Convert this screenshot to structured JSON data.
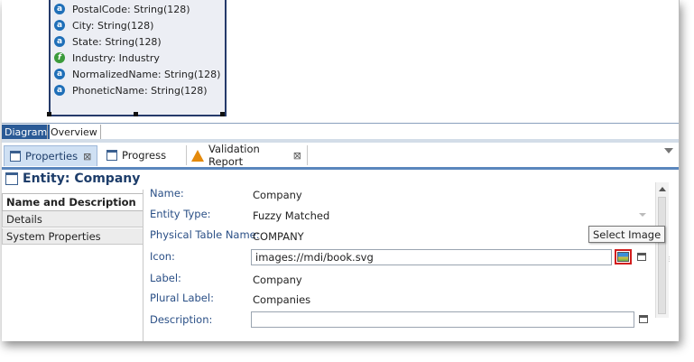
{
  "diagram": {
    "attributes": [
      {
        "type": "a",
        "text": "PostalCode: String(128)"
      },
      {
        "type": "a",
        "text": "City: String(128)"
      },
      {
        "type": "a",
        "text": "State: String(128)"
      },
      {
        "type": "f",
        "text": "Industry: Industry"
      },
      {
        "type": "a",
        "text": "NormalizedName: String(128)"
      },
      {
        "type": "a",
        "text": "PhoneticName: String(128)"
      }
    ],
    "tabs": {
      "diagram": "Diagram",
      "overview": "Overview"
    }
  },
  "view_tabs": {
    "properties": "Properties",
    "progress": "Progress",
    "validation": "Validation Report",
    "close_glyph": "⊠"
  },
  "entity_title": "Entity: Company",
  "sidebar": {
    "items": [
      "Name and Description",
      "Details",
      "System Properties"
    ]
  },
  "properties": {
    "name_label": "Name:",
    "name_value": "Company",
    "type_label": "Entity Type:",
    "type_value": "Fuzzy Matched",
    "table_label": "Physical Table Name:",
    "table_value": "COMPANY",
    "icon_label": "Icon:",
    "icon_value": "images://mdi/book.svg",
    "label_label": "Label:",
    "label_value": "Company",
    "plural_label": "Plural Label:",
    "plural_value": "Companies",
    "desc_label": "Description:",
    "desc_value": ""
  },
  "tooltip": "Select Image",
  "icons": {
    "attribute": "attribute-icon",
    "lookup": "lookup-attribute-icon",
    "warning": "warning-icon",
    "image": "select-image-icon",
    "window": "window-icon"
  },
  "colors": {
    "accent": "#2a5a96",
    "label": "#2a4f86",
    "highlight": "#d21d1d",
    "warning": "#e48a0c"
  }
}
